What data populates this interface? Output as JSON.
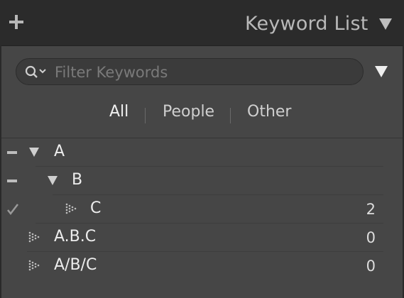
{
  "header": {
    "title": "Keyword List",
    "add_icon": "plus-icon",
    "collapse_icon": "triangle-down-icon"
  },
  "search": {
    "placeholder": "Filter Keywords",
    "value": ""
  },
  "tabs": [
    {
      "label": "All",
      "active": true
    },
    {
      "label": "People",
      "active": false
    },
    {
      "label": "Other",
      "active": false
    }
  ],
  "keywords": [
    {
      "label": "A",
      "state": "minus",
      "disclosure": "expanded",
      "count": "",
      "level": 0
    },
    {
      "label": "B",
      "state": "minus",
      "disclosure": "expanded",
      "count": "",
      "level": 1
    },
    {
      "label": "C",
      "state": "check",
      "disclosure": "leaf",
      "count": "2",
      "level": 2
    },
    {
      "label": "A.B.C",
      "state": "",
      "disclosure": "leaf",
      "count": "0",
      "level": 0
    },
    {
      "label": "A/B/C",
      "state": "",
      "disclosure": "leaf",
      "count": "0",
      "level": 0
    }
  ],
  "colors": {
    "header_bg": "#2b2b2b",
    "panel_bg": "#464646",
    "text": "#ededed",
    "muted_text": "#b9b9b9"
  }
}
